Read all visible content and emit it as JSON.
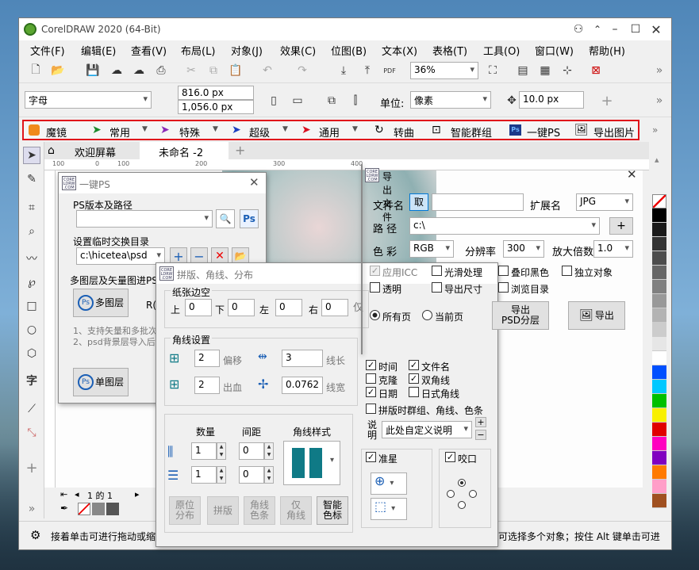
{
  "app": {
    "title": "CorelDRAW 2020 (64-Bit)"
  },
  "menu": [
    "文件(F)",
    "编辑(E)",
    "查看(V)",
    "布局(L)",
    "对象(J)",
    "效果(C)",
    "位图(B)",
    "文本(X)",
    "表格(T)",
    "工具(O)",
    "窗口(W)",
    "帮助(H)"
  ],
  "toolbar": {
    "zoom": "36%"
  },
  "propbar": {
    "font": "字母",
    "width": "816.0 px",
    "height": "1,056.0 px",
    "unit_label": "单位:",
    "unit": "像素",
    "nudge": "10.0 px"
  },
  "plugin_bar": {
    "items": [
      "魔镜",
      "常用",
      "特殊",
      "超级",
      "通用",
      "转曲",
      "智能群组",
      "一键PS",
      "导出图片"
    ]
  },
  "tabs": [
    "欢迎屏幕",
    "未命名 -2"
  ],
  "ruler": [
    "100",
    "0",
    "100",
    "200",
    "300",
    "400"
  ],
  "page_nav": "1 的 1",
  "status": {
    "left": "接着单击可进行拖动或缩",
    "right": "可选择多个对象；按住 Alt 键单击可进"
  },
  "ps_panel": {
    "title": "一键PS",
    "version_label": "PS版本及路径",
    "temp_label": "设置临时交换目录",
    "temp_path": "c:\\hicetea\\psd",
    "multi_label": "多图层及矢量图进PS",
    "multi_btn": "多图层",
    "single_btn": "单图层",
    "note1": "1、支持矢量和多批次",
    "note2": "2、psd背景层导入后",
    "partial": "R("
  },
  "impose_panel": {
    "title": "拼版、角线、分布",
    "margin_group": "纸张边空",
    "top": "上",
    "bottom": "下",
    "left": "左",
    "right": "右",
    "top_val": "0",
    "bottom_val": "0",
    "left_val": "0",
    "right_val": "0",
    "partial": "仅",
    "corner_group": "角线设置",
    "offset_val": "2",
    "offset_label": "偏移",
    "length_val": "3",
    "length_label": "线长",
    "bleed_val": "2",
    "bleed_label": "出血",
    "width_val": "0.0762",
    "width_label": "线宽",
    "count_label": "数量",
    "gap_label": "间距",
    "style_label": "角线样式",
    "count1": "1",
    "count2": "1",
    "gap1": "0",
    "gap2": "0",
    "btns": [
      "原位\n分布",
      "拼版",
      "角线\n色条",
      "仅\n角线",
      "智能\n色标"
    ],
    "checks": [
      {
        "label": "时间",
        "checked": true
      },
      {
        "label": "文件名",
        "checked": true
      },
      {
        "label": "克隆",
        "checked": false
      },
      {
        "label": "双角线",
        "checked": true
      },
      {
        "label": "日期",
        "checked": true
      },
      {
        "label": "日式角线",
        "checked": false
      }
    ],
    "group_note": "拼版时群组、角线、色条",
    "desc_label": "说明",
    "desc_value": "此处自定义说明",
    "target_label": "准星",
    "bite_label": "咬口"
  },
  "export_panel": {
    "title": "导出文件",
    "filename_label": "文件名",
    "fetch_btn": "取",
    "filename": "",
    "ext_label": "扩展名",
    "ext": "JPG",
    "path_label": "路 径",
    "path": "c:\\",
    "color_label": "色 彩",
    "color": "RGB",
    "res_label": "分辨率",
    "res": "300",
    "scale_label": "放大倍数",
    "scale": "1.0",
    "options": [
      {
        "label": "应用ICC",
        "checked": true,
        "disabled": true
      },
      {
        "label": "光滑处理",
        "checked": false
      },
      {
        "label": "叠印黑色",
        "checked": false
      },
      {
        "label": "独立对象",
        "checked": false
      },
      {
        "label": "透明",
        "checked": false
      },
      {
        "label": "导出尺寸",
        "checked": false
      },
      {
        "label": "浏览目录",
        "checked": false
      }
    ],
    "all_pages": "所有页",
    "current_page": "当前页",
    "layer_btn": "导出\nPSD分层",
    "export_btn": "导出"
  },
  "colors": {
    "accent_red": "#e0141a",
    "ps_blue": "#1b5fb5",
    "teal": "#0f7a86"
  }
}
